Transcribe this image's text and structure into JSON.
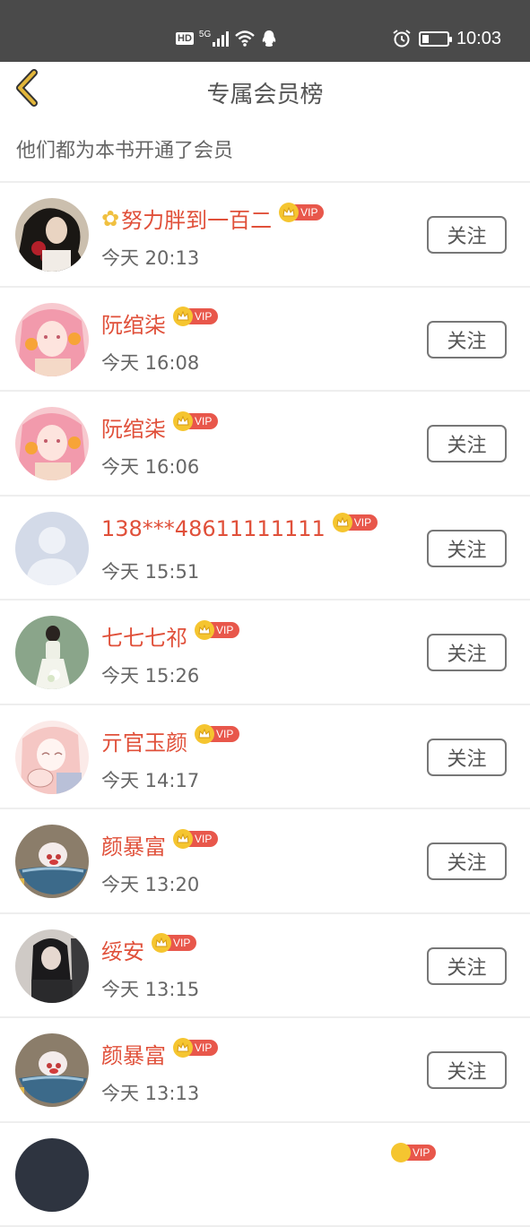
{
  "status_bar": {
    "network_badge": "HD",
    "network_type": "5G",
    "time": "10:03",
    "icons": [
      "hd-icon",
      "signal-icon",
      "wifi-icon",
      "qq-icon",
      "alarm-icon",
      "battery-icon"
    ],
    "battery_level": 0.25
  },
  "header": {
    "title": "专属会员榜",
    "back_icon": "chevron-left-icon"
  },
  "subtitle": "他们都为本书开通了会员",
  "vip_label": "VIP",
  "follow_label": "关注",
  "colors": {
    "name": "#e0503a",
    "vip_pill": "#e8574b",
    "crown": "#f5c530",
    "back_chevron": "#e2b63a",
    "status_bar": "#4a4a4a"
  },
  "members": [
    {
      "prefix": "✿",
      "name": "努力胖到一百二",
      "time": "今天 20:13",
      "avatar": "dark-hair-woman-avatar"
    },
    {
      "prefix": "",
      "name": "阮绾柒",
      "time": "今天 16:08",
      "avatar": "pink-anime-girl-avatar"
    },
    {
      "prefix": "",
      "name": "阮绾柒",
      "time": "今天 16:06",
      "avatar": "pink-anime-girl-avatar"
    },
    {
      "prefix": "",
      "name": "138***48611111111",
      "time": "今天 15:51",
      "avatar": "default-person-avatar"
    },
    {
      "prefix": "",
      "name": "七七七祁",
      "time": "今天 15:26",
      "avatar": "girl-green-background-avatar"
    },
    {
      "prefix": "",
      "name": "亓官玉颜",
      "time": "今天 14:17",
      "avatar": "sketch-girl-avatar"
    },
    {
      "prefix": "",
      "name": "颜暴富",
      "time": "今天 13:20",
      "avatar": "pig-in-bowl-avatar"
    },
    {
      "prefix": "",
      "name": "绥安",
      "time": "今天 13:15",
      "avatar": "dark-photo-girl-avatar"
    },
    {
      "prefix": "",
      "name": "颜暴富",
      "time": "今天 13:13",
      "avatar": "pig-in-bowl-avatar"
    }
  ]
}
